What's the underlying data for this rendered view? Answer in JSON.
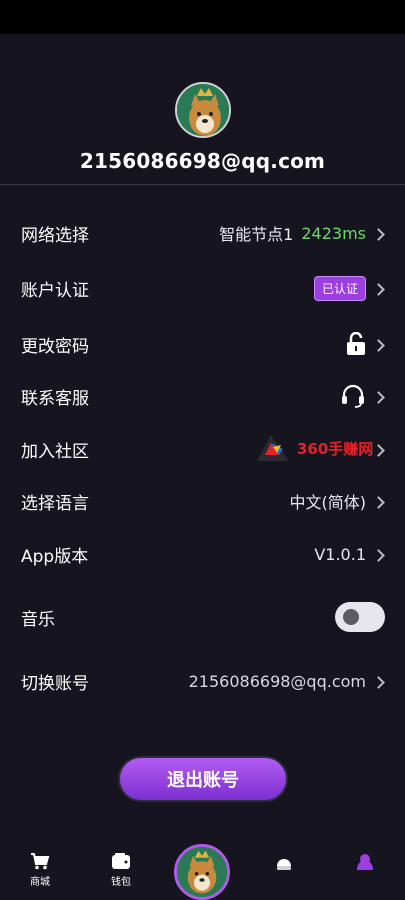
{
  "profile": {
    "email": "2156086698@qq.com"
  },
  "menu": {
    "network": {
      "label": "网络选择",
      "node": "智能节点1",
      "latency": "2423ms"
    },
    "auth": {
      "label": "账户认证",
      "badge": "已认证"
    },
    "password": {
      "label": "更改密码",
      "icon": "lock-open-icon"
    },
    "support": {
      "label": "联系客服",
      "icon": "headset-icon"
    },
    "community": {
      "label": "加入社区"
    },
    "language": {
      "label": "选择语言",
      "value": "中文(简体)"
    },
    "version": {
      "label": "App版本",
      "value": "V1.0.1"
    },
    "music": {
      "label": "音乐",
      "enabled": false
    },
    "switch_account": {
      "label": "切换账号",
      "value": "2156086698@qq.com"
    }
  },
  "watermark": {
    "text": "360手赚网"
  },
  "logout": {
    "label": "退出账号"
  },
  "tabbar": {
    "shop": {
      "label": "商城",
      "icon": "cart-icon"
    },
    "wallet": {
      "label": "钱包",
      "icon": "wallet-icon"
    },
    "center": {
      "icon": "avatar"
    },
    "item4": {
      "icon": "helmet-icon"
    },
    "item5": {
      "icon": "profile-icon"
    }
  },
  "colors": {
    "accent": "#9b3fe0",
    "latency": "#6cd96a",
    "background": "#16151f"
  }
}
